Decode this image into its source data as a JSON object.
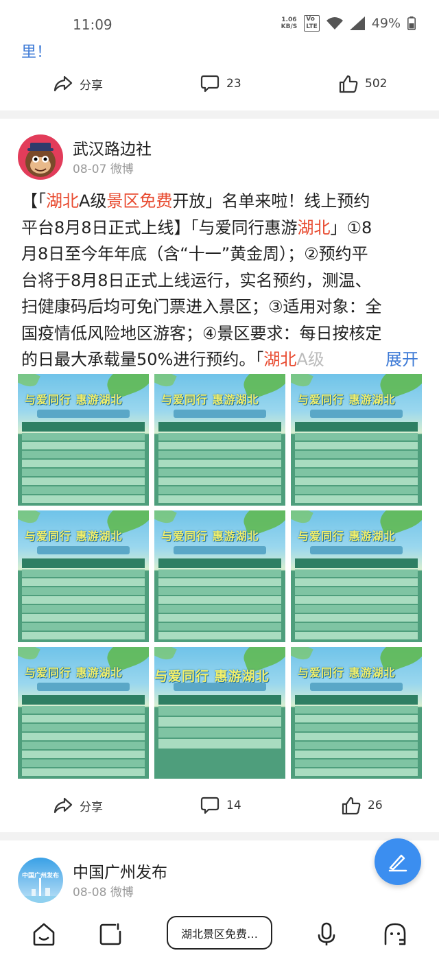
{
  "status": {
    "time": "11:09",
    "speed_value": "1.06",
    "speed_unit": "KB/S",
    "volte_top": "Vo",
    "volte_bottom": "LTE",
    "battery": "49%"
  },
  "prev_post": {
    "text_tail": "里！",
    "share_label": "分享",
    "comment_count": "23",
    "like_count": "502"
  },
  "post": {
    "author": "武汉路边社",
    "date": "08-07",
    "source": "微博",
    "body_lines": [
      [
        {
          "t": "【「"
        },
        {
          "t": "湖北",
          "c": "red"
        },
        {
          "t": "A级"
        },
        {
          "t": "景区免费",
          "c": "red"
        },
        {
          "t": "开放」名单来啦！线上预约"
        }
      ],
      [
        {
          "t": "平台8月8日正式上线】「与爱同行惠游"
        },
        {
          "t": "湖北",
          "c": "red"
        },
        {
          "t": "」①8"
        }
      ],
      [
        {
          "t": "月8日至今年年底（含“十一”黄金周）；②预约平"
        }
      ],
      [
        {
          "t": "台将于8月8日正式上线运行，实名预约，测温、"
        }
      ],
      [
        {
          "t": "扫健康码后均可免门票进入景区；③适用对象：全"
        }
      ],
      [
        {
          "t": "国疫情低风险地区游客；④景区要求：每日按核定"
        }
      ],
      [
        {
          "t": "的日最大承载量50%进行预约。「"
        },
        {
          "t": "湖北",
          "c": "red"
        },
        {
          "t": "A级",
          "c": "fade"
        }
      ]
    ],
    "expand_label": "展开",
    "images": [
      {
        "title": "与爱同行 惠游湖北"
      },
      {
        "title": "与爱同行 惠游湖北"
      },
      {
        "title": "与爱同行 惠游湖北"
      },
      {
        "title": "与爱同行 惠游湖北"
      },
      {
        "title": "与爱同行 惠游湖北"
      },
      {
        "title": "与爱同行 惠游湖北"
      },
      {
        "title": "与爱同行 惠游湖北"
      },
      {
        "title": "与爱同行 惠游湖北"
      },
      {
        "title": "与爱同行 惠游湖北"
      }
    ],
    "share_label": "分享",
    "comment_count": "14",
    "like_count": "26"
  },
  "next_post": {
    "author": "中国广州发布",
    "date": "08-08",
    "source": "微博",
    "avatar_text": "中国广州发布"
  },
  "bottom_nav": {
    "search_text": "湖北景区免费…"
  },
  "colors": {
    "accent": "#3d7ad6",
    "highlight": "#e84a2f",
    "fab": "#3b8ef0"
  },
  "icons": [
    "share-icon",
    "comment-icon",
    "like-icon",
    "home-icon",
    "discover-icon",
    "mic-icon",
    "profile-icon",
    "compose-icon"
  ]
}
